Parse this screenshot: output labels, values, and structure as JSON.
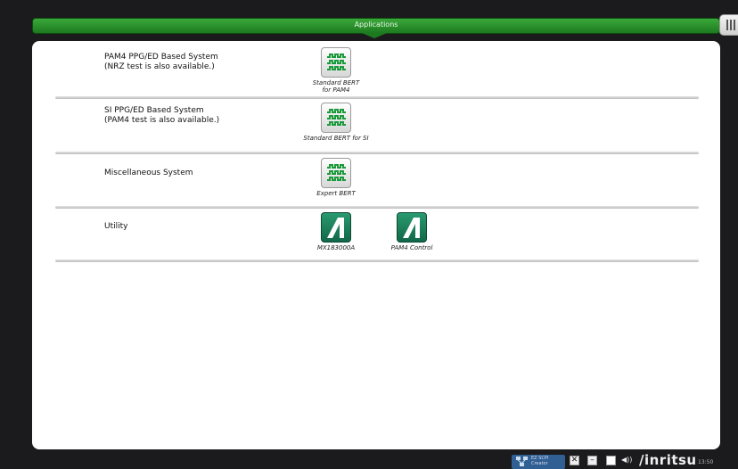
{
  "header": {
    "title": "Applications"
  },
  "sections": [
    {
      "label_line1": "PAM4 PPG/ED Based System",
      "label_line2": "(NRZ test is also available.)",
      "apps": [
        {
          "label": "Standard BERT for PAM4",
          "icon": "bert-waveform-icon"
        }
      ]
    },
    {
      "label_line1": "SI PPG/ED Based System",
      "label_line2": "(PAM4 test is also available.)",
      "apps": [
        {
          "label": "Standard BERT for SI",
          "icon": "bert-waveform-icon"
        }
      ]
    },
    {
      "label_line1": "Miscellaneous System",
      "label_line2": "",
      "apps": [
        {
          "label": "Expert BERT",
          "icon": "bert-waveform-icon"
        }
      ]
    },
    {
      "label_line1": "Utility",
      "label_line2": "",
      "apps": [
        {
          "label": "MX183000A",
          "icon": "anritsu-logo-icon"
        },
        {
          "label": "PAM4 Control",
          "icon": "anritsu-logo-icon"
        }
      ]
    }
  ],
  "status_bar": {
    "ez_scpi_line1": "EZ SCPI",
    "ez_scpi_line2": "Creator",
    "close_symbol": "✕",
    "minimize_symbol": "–",
    "speaker_symbol": "◀))",
    "brand": "/inritsu",
    "time": "13:50"
  },
  "colors": {
    "header_green": "#1d7a1f",
    "bert_icon_green": "#1a9a3a",
    "anritsu_icon_teal": "#1c8a62",
    "background": "#1b1b1d"
  }
}
